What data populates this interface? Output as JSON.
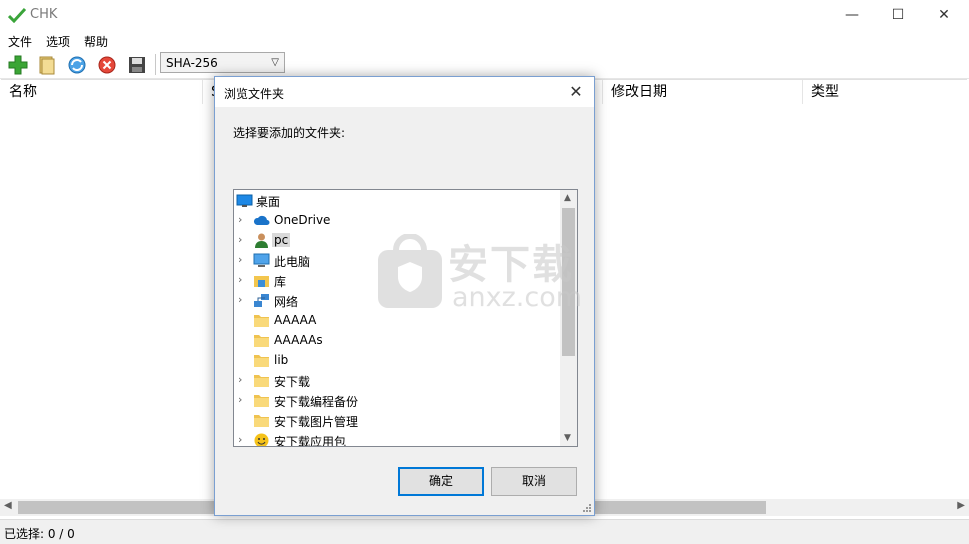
{
  "window": {
    "title": "CHK",
    "controls": {
      "minimize": "—",
      "maximize": "☐",
      "close": "✕"
    }
  },
  "menu": [
    "文件",
    "选项",
    "帮助"
  ],
  "toolbar": {
    "icons": [
      "add-icon",
      "open-folder-icon",
      "refresh-icon",
      "stop-icon",
      "save-icon"
    ],
    "hash_algorithm": "SHA-256"
  },
  "list": {
    "columns": [
      "名称",
      "S",
      "修改日期",
      "类型"
    ]
  },
  "status": {
    "selected": "已选择: 0 / 0"
  },
  "dialog": {
    "title": "浏览文件夹",
    "prompt": "选择要添加的文件夹:",
    "tree": [
      {
        "label": "桌面",
        "icon": "desktop-icon",
        "expandable": false,
        "top": true
      },
      {
        "label": "OneDrive",
        "icon": "cloud-icon",
        "expandable": true
      },
      {
        "label": "pc",
        "icon": "user-icon",
        "expandable": true,
        "selected": true
      },
      {
        "label": "此电脑",
        "icon": "computer-icon",
        "expandable": true
      },
      {
        "label": "库",
        "icon": "library-icon",
        "expandable": true
      },
      {
        "label": "网络",
        "icon": "network-icon",
        "expandable": true
      },
      {
        "label": "AAAAA",
        "icon": "folder-icon",
        "expandable": false
      },
      {
        "label": "AAAAAs",
        "icon": "folder-icon",
        "expandable": false
      },
      {
        "label": "lib",
        "icon": "folder-icon",
        "expandable": false
      },
      {
        "label": "安下载",
        "icon": "folder-icon",
        "expandable": true
      },
      {
        "label": "安下载编程备份",
        "icon": "folder-icon",
        "expandable": true
      },
      {
        "label": "安下载图片管理",
        "icon": "folder-icon",
        "expandable": false
      },
      {
        "label": "安下载应用包",
        "icon": "smiley-folder-icon",
        "expandable": true
      }
    ],
    "ok_label": "确定",
    "cancel_label": "取消"
  },
  "watermark": {
    "text": "安下载",
    "sub": "anxz.com"
  },
  "colors": {
    "accent": "#0078d7",
    "folder": "#f7d774",
    "dialog_bg": "#f0f0f0"
  }
}
